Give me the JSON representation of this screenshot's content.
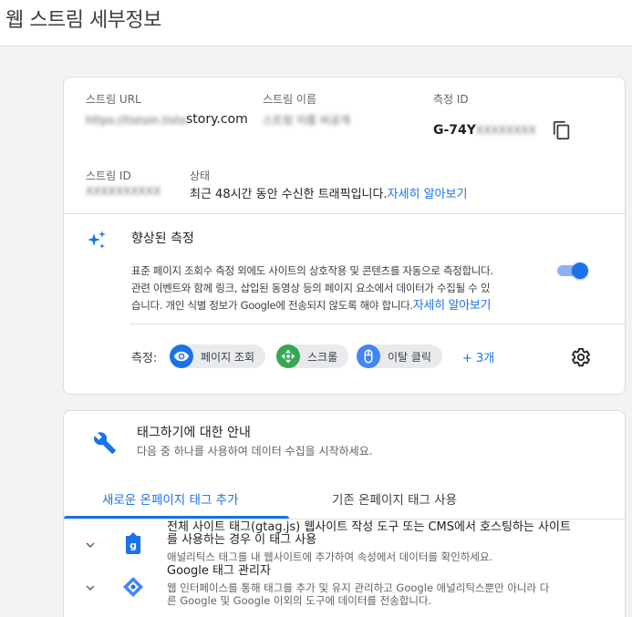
{
  "header": {
    "title": "웹 스트림 세부정보"
  },
  "stream": {
    "url_label": "스트림 URL",
    "url_value_hidden": "https://tistoin.tistory.com",
    "url_value_suffix": "story.com",
    "name_label": "스트림 이름",
    "name_value_hidden": "스트림 이름 비공개",
    "measurement_label": "측정 ID",
    "measurement_prefix": "G-74Y",
    "measurement_hidden": "XXXXXXXX",
    "id_label": "스트림 ID",
    "id_value_hidden": "XXXXXXXXXX",
    "status_label": "상태",
    "status_value": "최근 48시간 동안 수신한 트래픽입니다.",
    "status_link": "자세히 알아보기"
  },
  "enhanced": {
    "title": "향상된 측정",
    "desc_line1": "표준 페이지 조회수 측정 외에도 사이트의 상호작용 및 콘텐츠를 자동으로 측정합니다.",
    "desc_line2": "관련 이벤트와 함께 링크, 삽입된 동영상 등의 페이지 요소에서 데이터가 수집될 수 있",
    "desc_line3": "습니다. 개인 식별 정보가 Google에 전송되지 않도록 해야 합니다.",
    "desc_link": "자세히 알아보기",
    "toggle_on": true,
    "measure_label": "측정:",
    "chips": [
      {
        "label": "페이지 조회",
        "icon": "eye-icon"
      },
      {
        "label": "스크롤",
        "icon": "scroll-icon"
      },
      {
        "label": "이탈 클릭",
        "icon": "mouse-icon"
      }
    ],
    "more": "+ 3개"
  },
  "tagging": {
    "title": "태그하기에 대한 안내",
    "subtitle": "다음 중 하나를 사용하여 데이터 수집을 시작하세요.",
    "tabs": [
      {
        "label": "새로운 온페이지 태그 추가",
        "active": true
      },
      {
        "label": "기존 온페이지 태그 사용",
        "active": false
      }
    ],
    "options": [
      {
        "title_line1": "전체 사이트 태그(gtag.js) 웹사이트 작성 도구 또는 CMS에서 호스팅하는 사이트",
        "title_line2": "를 사용하는 경우 이 태그 사용",
        "desc": "애널리틱스 태그를 내 웹사이트에 추가하여 속성에서 데이터를 확인하세요.",
        "icon": "gtag-icon"
      },
      {
        "title_line1": "Google 태그 관리자",
        "desc_line1": "웹 인터페이스를 통해 태그를 추가 및 유지 관리하고 Google 애널리틱스뿐만 아니라 다",
        "desc_line2": "른 Google 및 Google 이외의 도구에 데이터를 전송합니다.",
        "icon": "tag-manager-icon"
      }
    ]
  },
  "colors": {
    "accent": "#1a73e8",
    "chip_bg": "#e8eaed",
    "page_bg": "#f1f3f4"
  }
}
